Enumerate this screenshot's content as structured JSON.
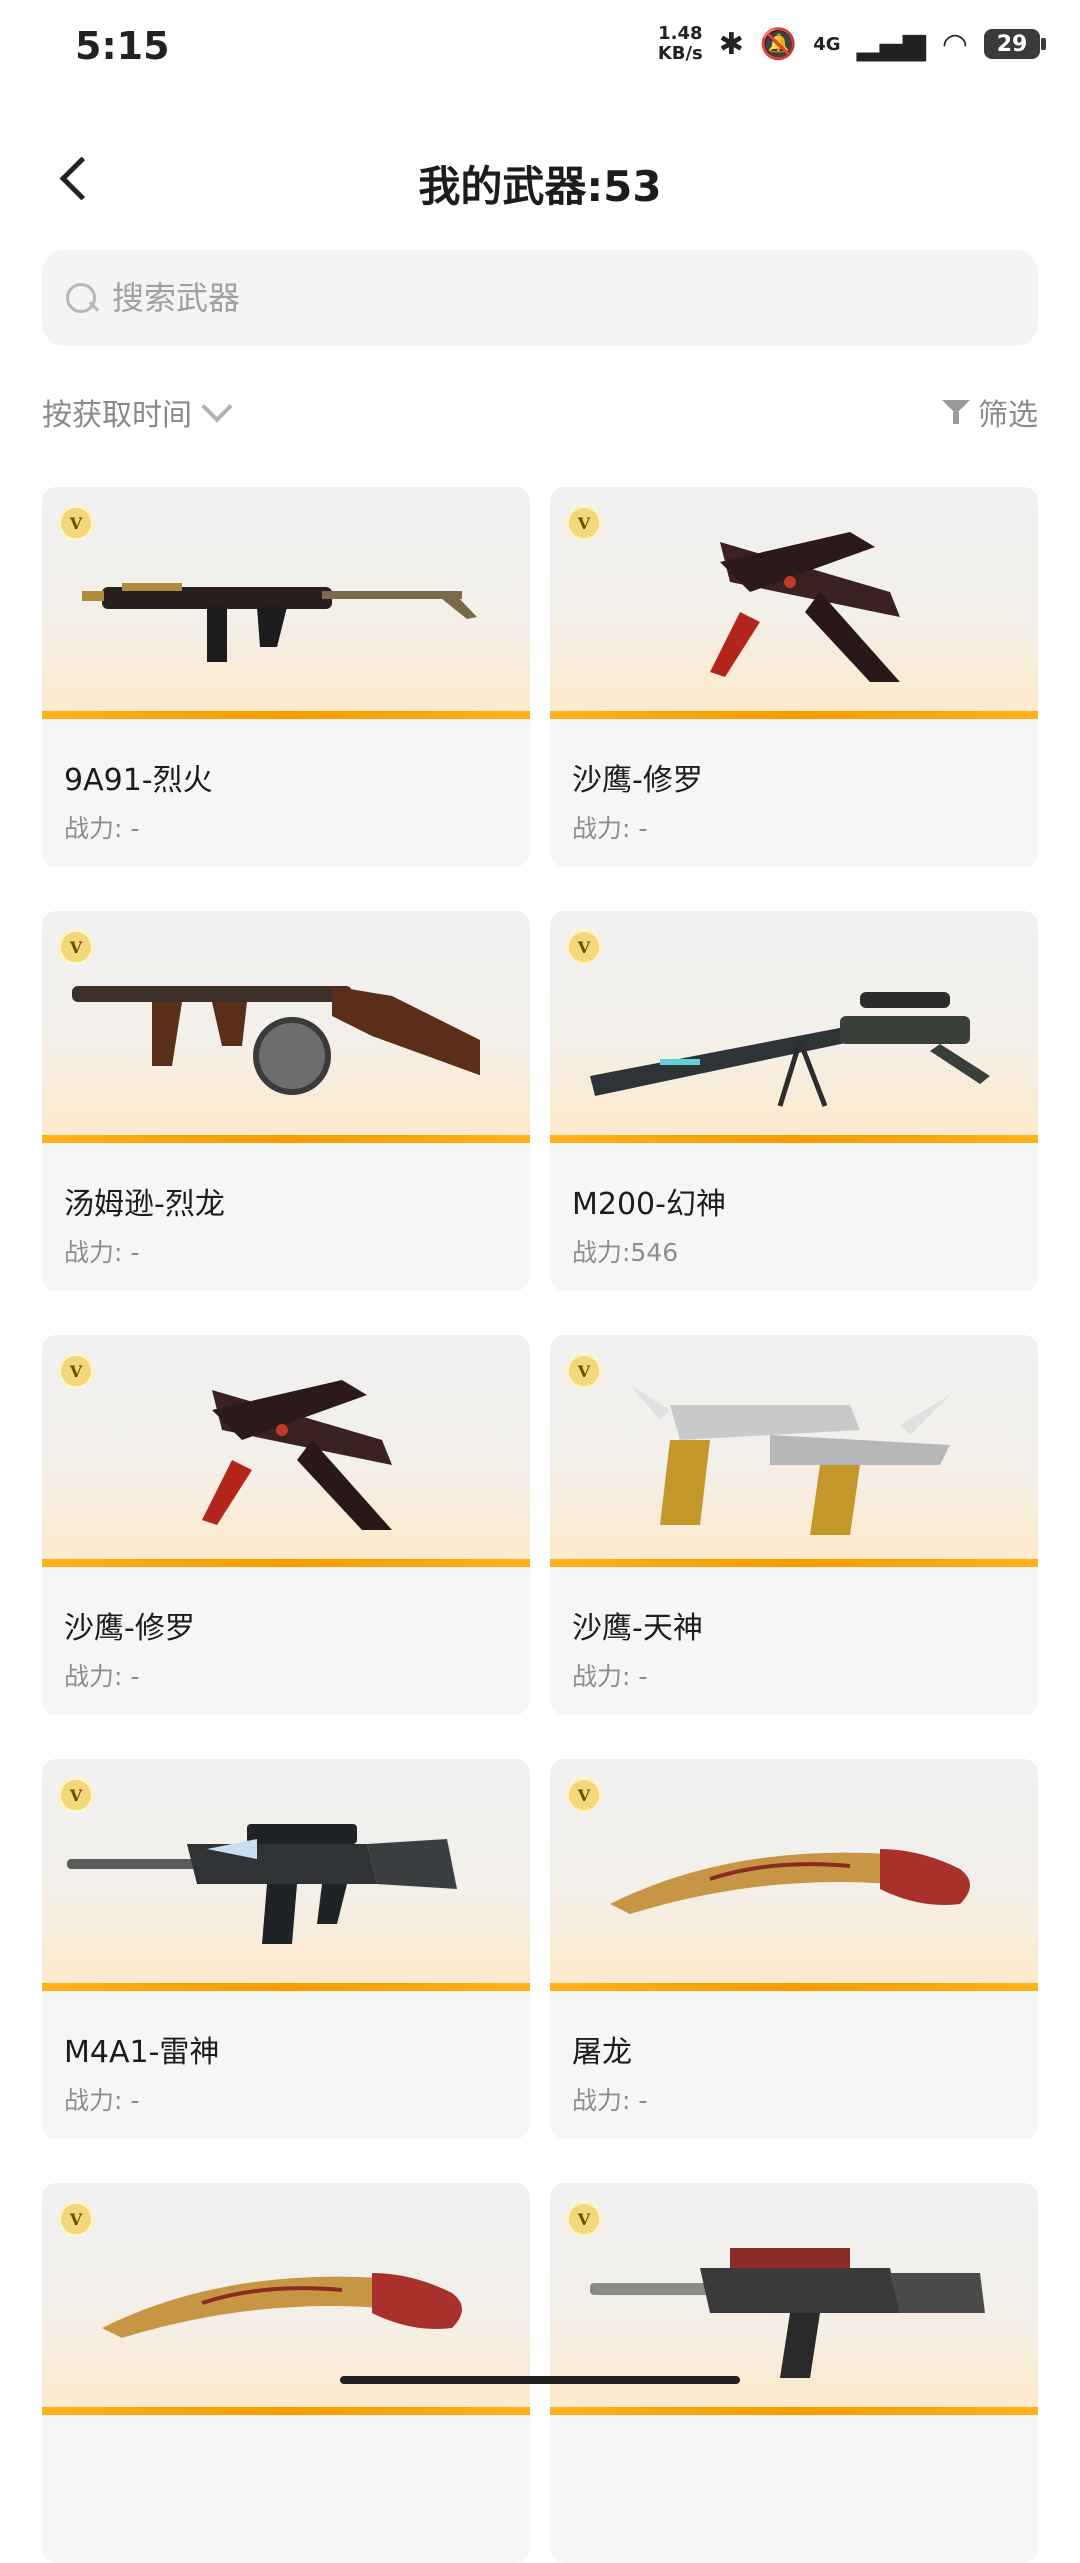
{
  "status": {
    "time": "5:15",
    "net_speed_value": "1.48",
    "net_speed_unit": "KB/s",
    "bluetooth_icon": "bluetooth-icon",
    "mute_icon": "bell-off-icon",
    "network": "4G",
    "battery": "29"
  },
  "header": {
    "title": "我的武器:53"
  },
  "search": {
    "placeholder": "搜索武器"
  },
  "sort": {
    "label": "按获取时间",
    "filter_label": "筛选"
  },
  "badge": "V",
  "weapons": [
    {
      "name": "9A91-烈火",
      "power": "战力: -"
    },
    {
      "name": "沙鹰-修罗",
      "power": "战力: -"
    },
    {
      "name": "汤姆逊-烈龙",
      "power": "战力: -"
    },
    {
      "name": "M200-幻神",
      "power": "战力:546"
    },
    {
      "name": "沙鹰-修罗",
      "power": "战力: -"
    },
    {
      "name": "沙鹰-天神",
      "power": "战力: -"
    },
    {
      "name": "M4A1-雷神",
      "power": "战力: -"
    },
    {
      "name": "屠龙",
      "power": "战力: -"
    },
    {
      "name": "",
      "power": ""
    },
    {
      "name": "",
      "power": ""
    }
  ]
}
